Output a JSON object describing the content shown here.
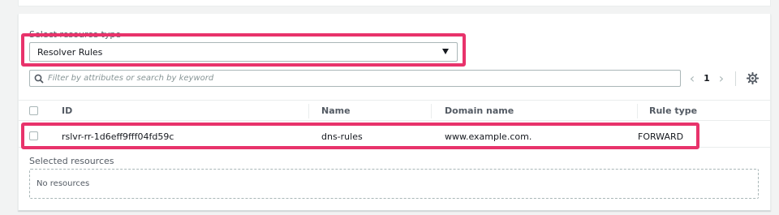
{
  "resource_type": {
    "label": "Select resource type",
    "selected": "Resolver Rules"
  },
  "search": {
    "placeholder": "Filter by attributes or search by keyword"
  },
  "pagination": {
    "prev": "‹",
    "current_page": "1",
    "next": "›"
  },
  "table": {
    "columns": [
      "ID",
      "Name",
      "Domain name",
      "Rule type"
    ],
    "rows": [
      {
        "id": "rslvr-rr-1d6eff9fff04fd59c",
        "name": "dns-rules",
        "domain_name": "www.example.com.",
        "rule_type": "FORWARD"
      }
    ]
  },
  "selected_resources": {
    "label": "Selected resources",
    "empty_text": "No resources"
  },
  "colors": {
    "highlight": "#e8336b",
    "border": "#aab7b8",
    "text": "#16191f",
    "muted": "#545b64"
  }
}
